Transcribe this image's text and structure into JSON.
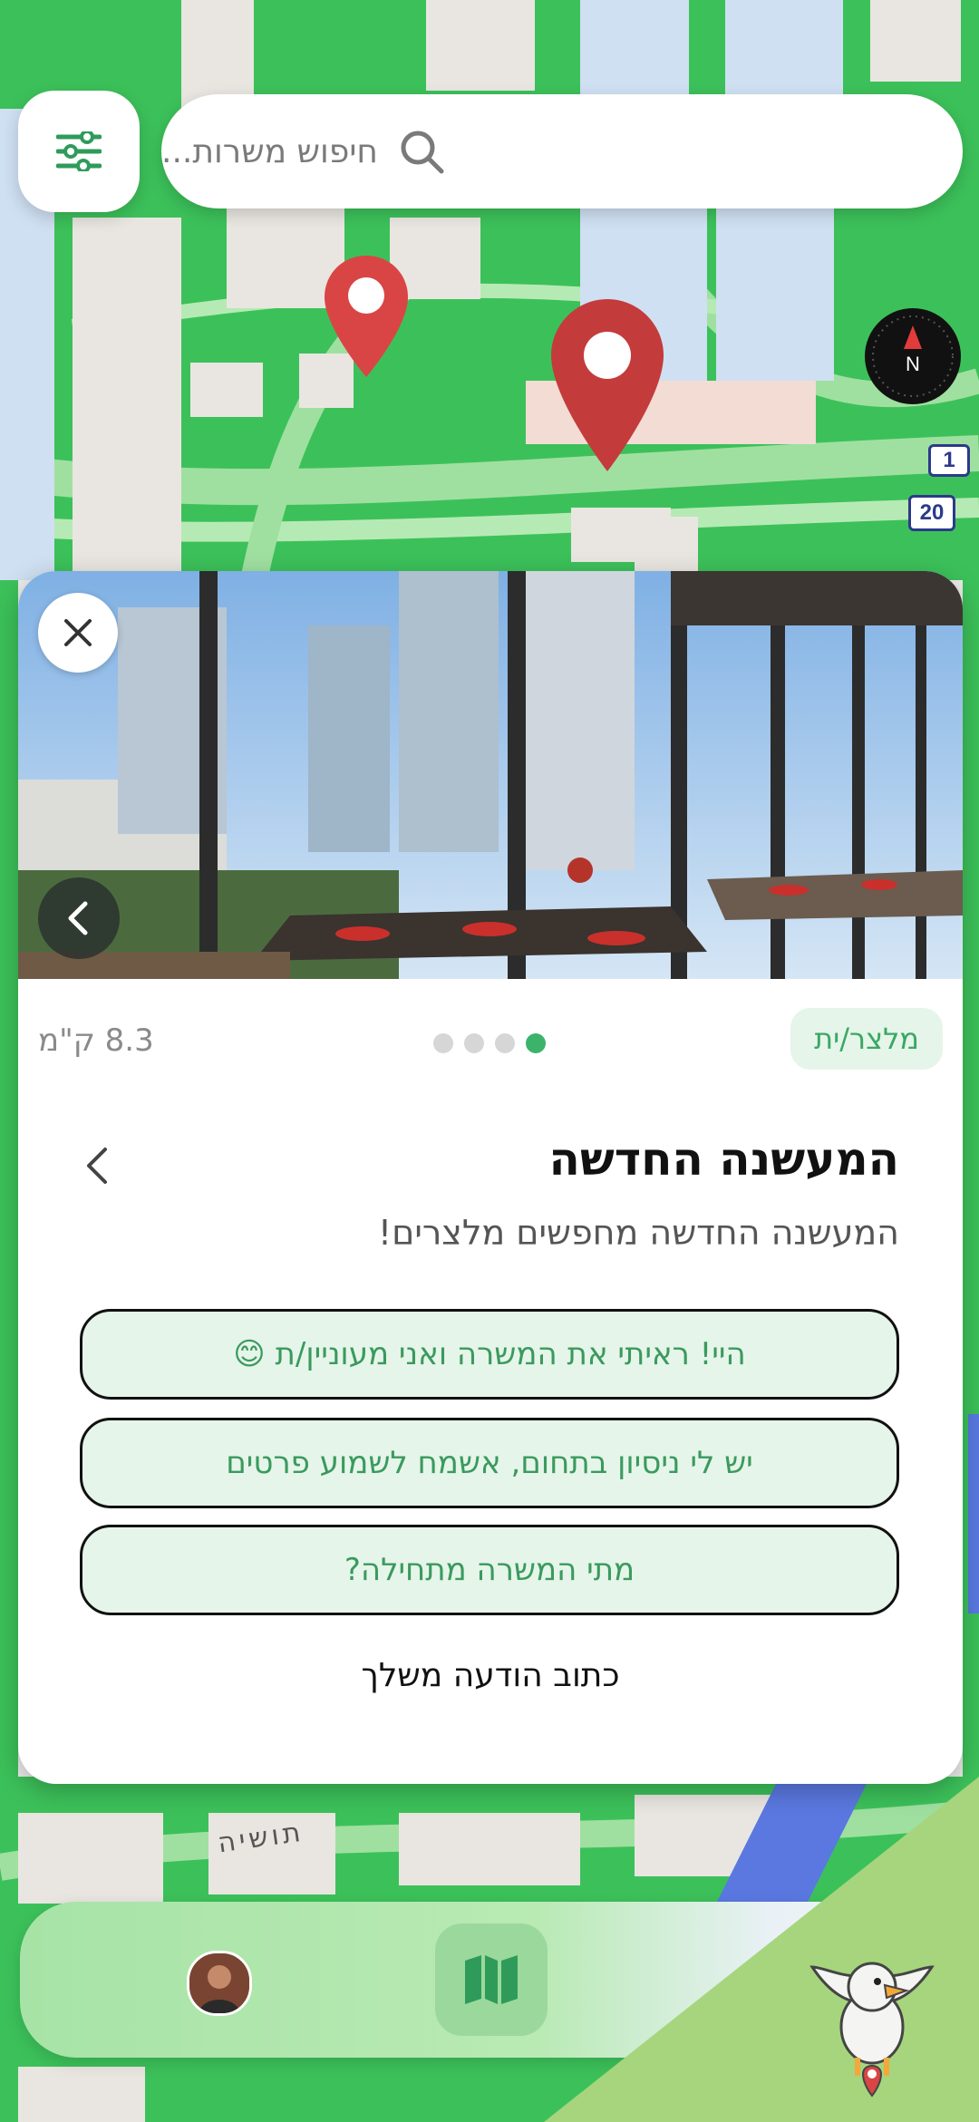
{
  "search": {
    "placeholder": "חיפוש משרות..."
  },
  "map": {
    "compass_label": "N",
    "highway_signs": [
      "1",
      "20"
    ],
    "street_label": "תושיה"
  },
  "job_card": {
    "distance": "8.3 ק\"מ",
    "badge": "מלצר/ית",
    "pagination": {
      "count": 4,
      "active_index": 3
    },
    "title": "המעשנה החדשה",
    "subtitle": "המעשנה החדשה מחפשים מלצרים!",
    "quick_replies": [
      "היי! ראיתי את המשרה ואני מעוניין/ת 😊",
      "יש לי ניסיון בתחום, אשמח לשמוע פרטים",
      "מתי המשרה מתחילה?"
    ],
    "write_own": "כתוב הודעה משלך"
  },
  "colors": {
    "accent": "#3cb36b",
    "pin": "#d94545",
    "map_green": "#3cc15a"
  }
}
